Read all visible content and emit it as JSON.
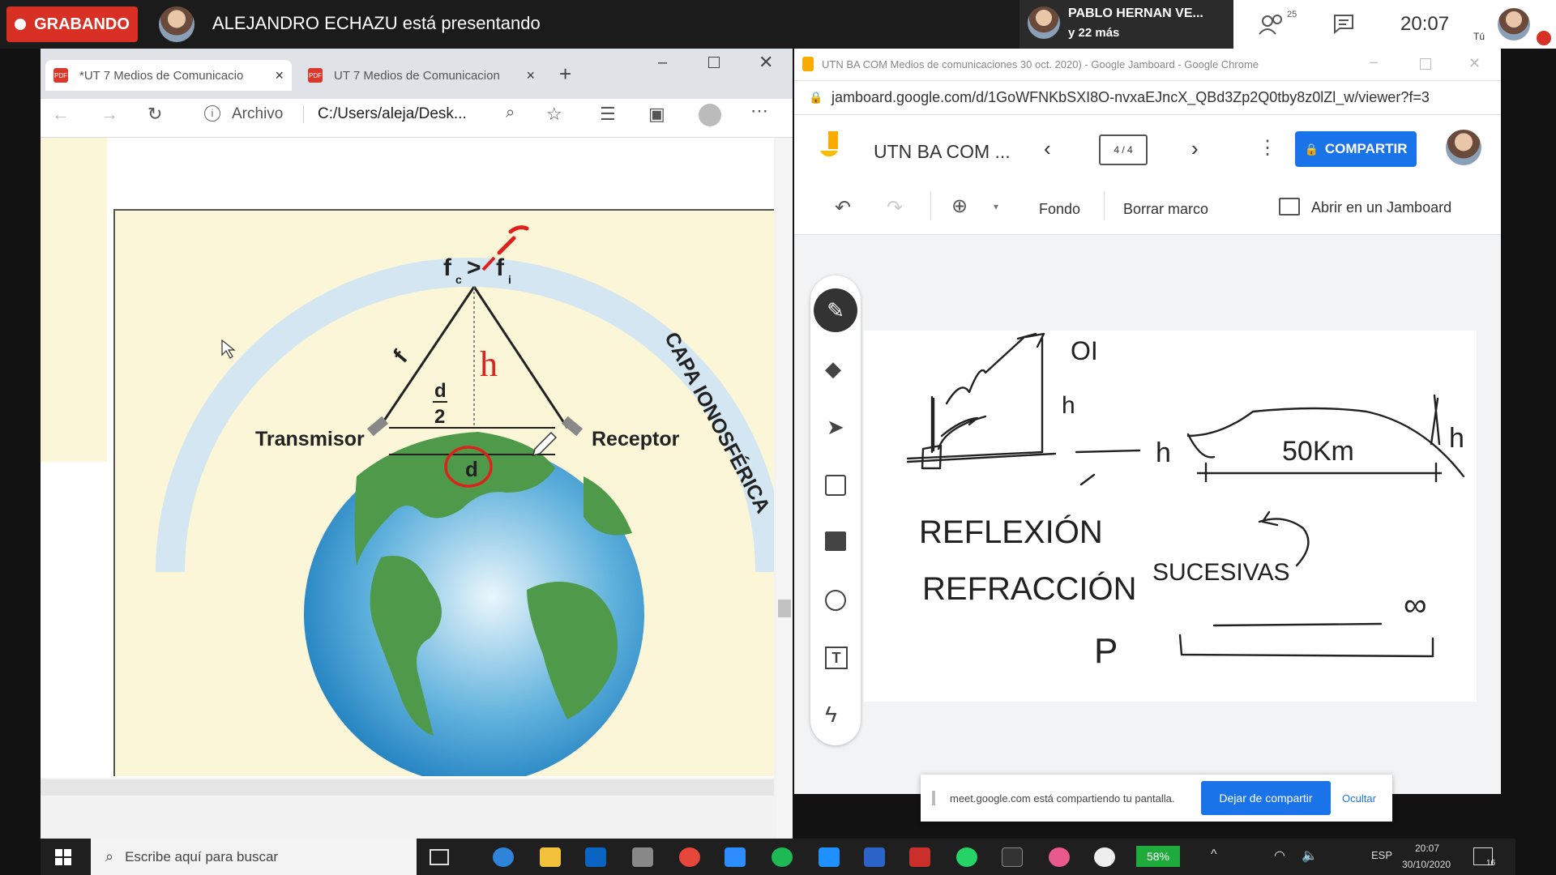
{
  "meet": {
    "recording_label": "GRABANDO",
    "presenting_text": "ALEJANDRO ECHAZU está presentando",
    "pinned_name": "PABLO HERNAN VE...",
    "pinned_more": "y 22 más",
    "participants_count": "25",
    "time": "20:07",
    "self_label": "Tú"
  },
  "edge": {
    "tabs": [
      {
        "label": "*UT 7 Medios de Comunicacio"
      },
      {
        "label": "UT 7 Medios de Comunicacion"
      }
    ],
    "address_prefix": "Archivo",
    "address": "C:/Users/aleja/Desk..."
  },
  "diagram": {
    "fc_label": "f",
    "fc_sub": "c",
    "gt": ">",
    "fi_label": "f",
    "fi_sub": "i",
    "h_label": "h",
    "f_label": "f",
    "d_num": "d",
    "d_den": "2",
    "d_label": "d",
    "transmitter": "Transmisor",
    "receiver": "Receptor",
    "layer": "CAPA IONOSFÉRICA"
  },
  "jamboard": {
    "window_title": "UTN BA COM Medios de comunicaciones 30 oct. 2020) - Google Jamboard - Google Chrome",
    "url": "jamboard.google.com/d/1GoWFNKbSXI8O-nvxaEJncX_QBd3Zp2Q0tby8z0lZl_w/viewer?f=3",
    "doc_title": "UTN BA COM ...",
    "frame_counter": "4 / 4",
    "share_label": "COMPARTIR",
    "toolbar": {
      "background": "Fondo",
      "clear": "Borrar marco",
      "open": "Abrir en un Jamboard"
    },
    "sharing_notice": "meet.google.com está compartiendo tu pantalla.",
    "stop_sharing": "Dejar de compartir",
    "hide": "Ocultar"
  },
  "handwriting": {
    "oi": "OI",
    "h": "h",
    "distance": "50Km",
    "reflexion": "REFLEXIÓN",
    "refraccion": "REFRACCIÓN",
    "sucesivas": "SUCESIVAS",
    "p": "P",
    "infinity": "∞"
  },
  "taskbar": {
    "search_placeholder": "Escribe aquí para buscar",
    "battery": "58%",
    "lang": "ESP",
    "time": "20:07",
    "date": "30/10/2020",
    "notif_count": "16"
  }
}
